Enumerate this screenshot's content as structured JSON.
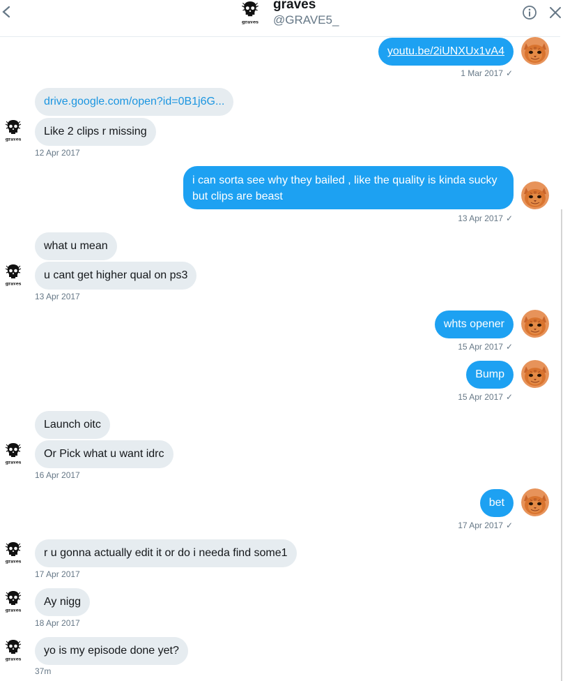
{
  "header": {
    "name": "graves",
    "handle": "@GRAVE5_"
  },
  "colors": {
    "outgoing_bubble": "#1da1f2",
    "incoming_bubble": "#e6ecf0",
    "meta_text": "#657786"
  },
  "messages": {
    "m1": {
      "text": "youtu.be/2iUNXUx1vA4",
      "time": "1 Mar 2017"
    },
    "m2": {
      "text": "drive.google.com/open?id=0B1j6G..."
    },
    "m3": {
      "text": "Like 2 clips r missing",
      "time": "12 Apr 2017"
    },
    "m4": {
      "text": "i can sorta see why they bailed , like the quality is kinda sucky but clips are beast",
      "time": "13 Apr 2017"
    },
    "m5": {
      "text": "what u mean"
    },
    "m6": {
      "text": "u cant get higher qual on ps3",
      "time": "13 Apr 2017"
    },
    "m7": {
      "text": "whts opener",
      "time": "15 Apr 2017"
    },
    "m8": {
      "text": "Bump",
      "time": "15 Apr 2017"
    },
    "m9": {
      "text": "Launch oitc"
    },
    "m10": {
      "text": "Or Pick what u want idrc",
      "time": "16 Apr 2017"
    },
    "m11": {
      "text": "bet",
      "time": "17 Apr 2017"
    },
    "m12": {
      "text": "r u gonna actually edit it or do i needa find some1",
      "time": "17 Apr 2017"
    },
    "m13": {
      "text": "Ay nigg",
      "time": "18 Apr 2017"
    },
    "m14": {
      "text": "yo is my episode done yet?",
      "time": "37m"
    }
  },
  "read_mark": "✓",
  "icons": {
    "back": "chevron-left-icon",
    "info": "info-icon",
    "close": "close-icon",
    "sender_avatar": "skull-avatar",
    "own_avatar": "cat-avatar"
  }
}
